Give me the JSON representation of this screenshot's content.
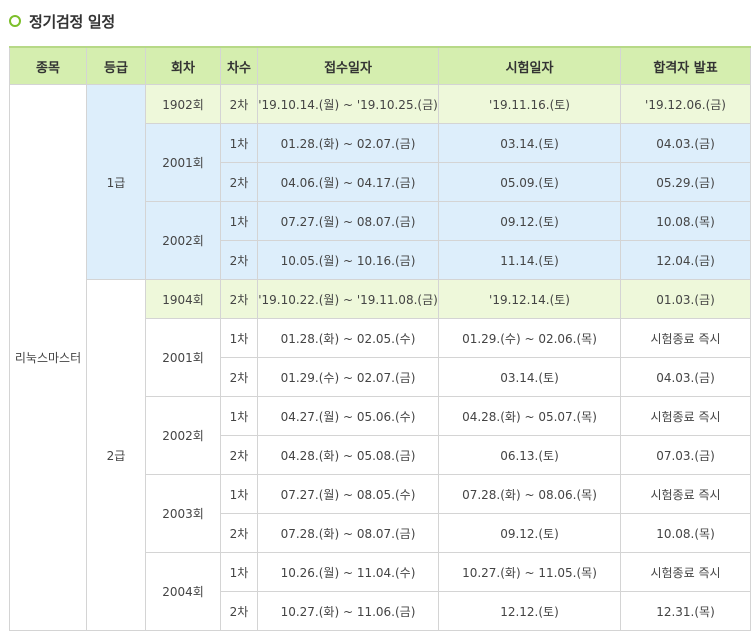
{
  "title": "정기검정 일정",
  "headers": [
    "종목",
    "등급",
    "회차",
    "차수",
    "접수일자",
    "시험일자",
    "합격자 발표"
  ],
  "subject": "리눅스마스터",
  "grades": [
    "1급",
    "2급"
  ],
  "g1": {
    "r1902": {
      "round": "1902회",
      "seq": "2차",
      "reg": "'19.10.14.(월) ~ '19.10.25.(금)",
      "exam": "'19.11.16.(토)",
      "result": "'19.12.06.(금)"
    },
    "r2001": {
      "round": "2001회",
      "s1": {
        "seq": "1차",
        "reg": "01.28.(화) ~ 02.07.(금)",
        "exam": "03.14.(토)",
        "result": "04.03.(금)"
      },
      "s2": {
        "seq": "2차",
        "reg": "04.06.(월) ~ 04.17.(금)",
        "exam": "05.09.(토)",
        "result": "05.29.(금)"
      }
    },
    "r2002": {
      "round": "2002회",
      "s1": {
        "seq": "1차",
        "reg": "07.27.(월) ~ 08.07.(금)",
        "exam": "09.12.(토)",
        "result": "10.08.(목)"
      },
      "s2": {
        "seq": "2차",
        "reg": "10.05.(월) ~ 10.16.(금)",
        "exam": "11.14.(토)",
        "result": "12.04.(금)"
      }
    }
  },
  "g2": {
    "r1904": {
      "round": "1904회",
      "seq": "2차",
      "reg": "'19.10.22.(월) ~ '19.11.08.(금)",
      "exam": "'19.12.14.(토)",
      "result": "01.03.(금)"
    },
    "r2001": {
      "round": "2001회",
      "s1": {
        "seq": "1차",
        "reg": "01.28.(화) ~ 02.05.(수)",
        "exam": "01.29.(수) ~ 02.06.(목)",
        "result": "시험종료 즉시"
      },
      "s2": {
        "seq": "2차",
        "reg": "01.29.(수) ~ 02.07.(금)",
        "exam": "03.14.(토)",
        "result": "04.03.(금)"
      }
    },
    "r2002": {
      "round": "2002회",
      "s1": {
        "seq": "1차",
        "reg": "04.27.(월) ~ 05.06.(수)",
        "exam": "04.28.(화) ~ 05.07.(목)",
        "result": "시험종료 즉시"
      },
      "s2": {
        "seq": "2차",
        "reg": "04.28.(화) ~ 05.08.(금)",
        "exam": "06.13.(토)",
        "result": "07.03.(금)"
      }
    },
    "r2003": {
      "round": "2003회",
      "s1": {
        "seq": "1차",
        "reg": "07.27.(월) ~ 08.05.(수)",
        "exam": "07.28.(화) ~ 08.06.(목)",
        "result": "시험종료 즉시"
      },
      "s2": {
        "seq": "2차",
        "reg": "07.28.(화) ~ 08.07.(금)",
        "exam": "09.12.(토)",
        "result": "10.08.(목)"
      }
    },
    "r2004": {
      "round": "2004회",
      "s1": {
        "seq": "1차",
        "reg": "10.26.(월) ~ 11.04.(수)",
        "exam": "10.27.(화) ~ 11.05.(목)",
        "result": "시험종료 즉시"
      },
      "s2": {
        "seq": "2차",
        "reg": "10.27.(화) ~ 11.06.(금)",
        "exam": "12.12.(토)",
        "result": "12.31.(목)"
      }
    }
  }
}
